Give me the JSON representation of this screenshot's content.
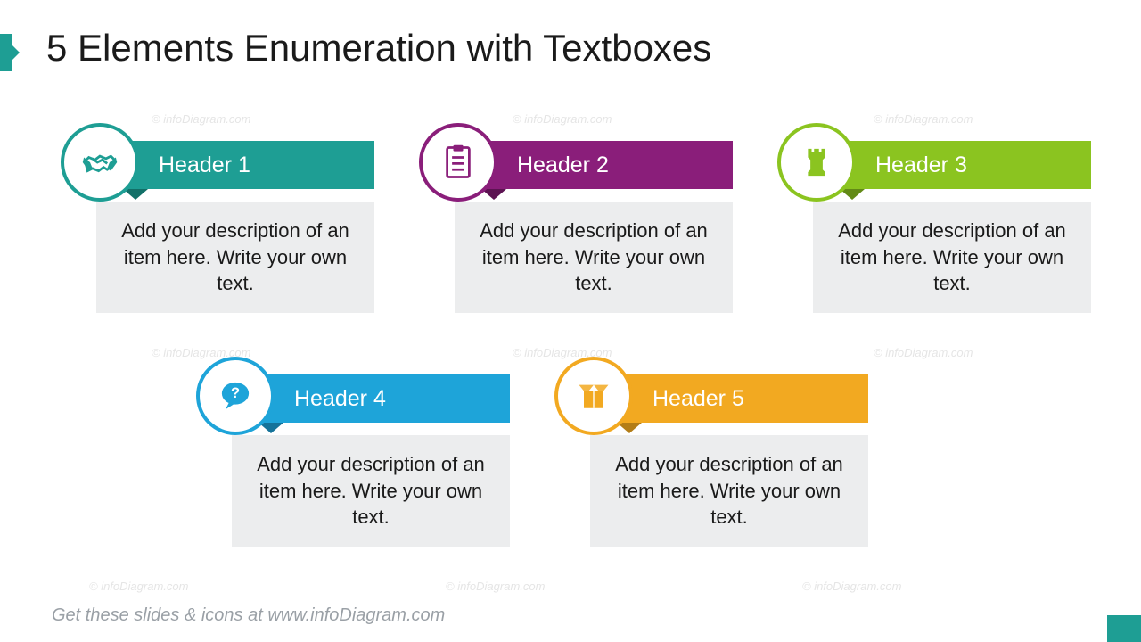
{
  "title": "5 Elements Enumeration with Textboxes",
  "footer": "Get these slides & icons at www.infoDiagram.com",
  "watermark": "© infoDiagram.com",
  "items": [
    {
      "header": "Header 1",
      "body": "Add your description of an item here. Write your own text.",
      "icon": "handshake-icon",
      "color": "#1e9e94"
    },
    {
      "header": "Header 2",
      "body": "Add your description of an item here. Write your own text.",
      "icon": "clipboard-icon",
      "color": "#8a1e7a"
    },
    {
      "header": "Header 3",
      "body": "Add your description of an item here. Write your own text.",
      "icon": "chess-rook-icon",
      "color": "#8bc420"
    },
    {
      "header": "Header 4",
      "body": "Add your description of an item here. Write your own text.",
      "icon": "speech-bubble-icon",
      "color": "#1ea4d9"
    },
    {
      "header": "Header 5",
      "body": "Add your description of an item here. Write your own text.",
      "icon": "open-box-icon",
      "color": "#f2a921"
    }
  ]
}
